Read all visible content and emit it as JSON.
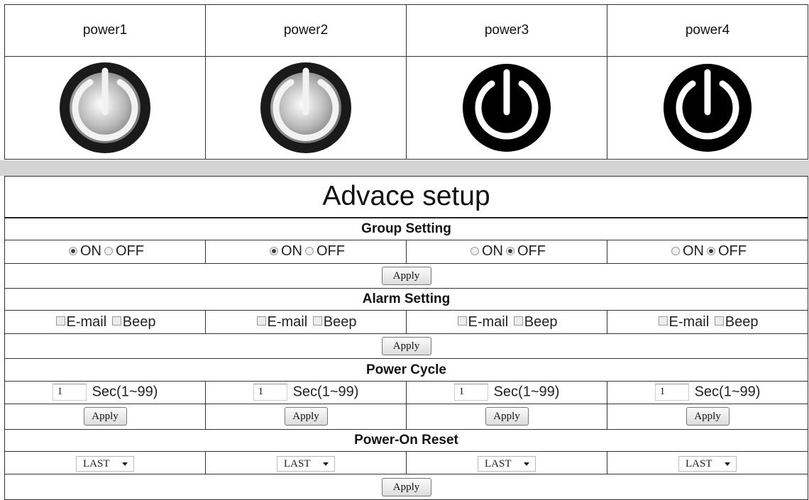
{
  "outlets": [
    {
      "label": "power1",
      "state": "off"
    },
    {
      "label": "power2",
      "state": "off"
    },
    {
      "label": "power3",
      "state": "on"
    },
    {
      "label": "power4",
      "state": "on"
    }
  ],
  "advance": {
    "title": "Advace setup",
    "group_setting": {
      "heading": "Group Setting",
      "on_label": "ON",
      "off_label": "OFF",
      "selected": [
        "ON",
        "ON",
        "OFF",
        "OFF"
      ],
      "apply": "Apply"
    },
    "alarm_setting": {
      "heading": "Alarm Setting",
      "email_label": "E-mail",
      "beep_label": "Beep",
      "apply": "Apply"
    },
    "power_cycle": {
      "heading": "Power Cycle",
      "values": [
        "1",
        "1",
        "1",
        "1"
      ],
      "unit_label": "Sec(1~99)",
      "apply": "Apply"
    },
    "power_on_reset": {
      "heading": "Power-On Reset",
      "values": [
        "LAST",
        "LAST",
        "LAST",
        "LAST"
      ],
      "apply": "Apply"
    }
  }
}
